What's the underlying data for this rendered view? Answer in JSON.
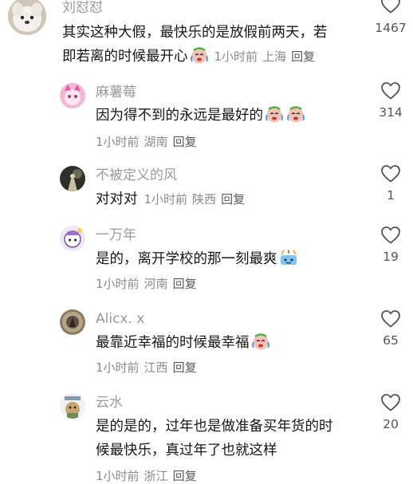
{
  "comments": [
    {
      "name": "刘怼怼",
      "lines": [
        "其实这种大假，最快乐的是放假前两天，若",
        "即若离的时候最开心"
      ],
      "emoji": "crying-face-emoji",
      "time": "1小时前",
      "location": "上海",
      "reply": "回复",
      "likes": "1467",
      "avatar": "white-dog-avatar"
    },
    {
      "name": "麻薯莓",
      "lines": [
        "因为得不到的永远是最好的"
      ],
      "emoji": "crying-face-emoji",
      "time": "1小时前",
      "location": "湖南",
      "reply": "回复",
      "likes": "314",
      "avatar": "pink-character-avatar"
    },
    {
      "name": "不被定义的风",
      "lines": [
        "对对对"
      ],
      "time": "1小时前",
      "location": "陕西",
      "reply": "回复",
      "likes": "1",
      "avatar": "dark-figure-avatar"
    },
    {
      "name": "一万年",
      "lines": [
        "是的，离开学校的那一刻最爽"
      ],
      "emoji": "celebration-emoji",
      "time": "1小时前",
      "location": "河南",
      "reply": "回复",
      "likes": "19",
      "avatar": "purple-character-avatar"
    },
    {
      "name": "Alicx. x",
      "lines": [
        "最靠近幸福的时候最幸福"
      ],
      "emoji": "crying-face-emoji",
      "time": "1小时前",
      "location": "江西",
      "reply": "回复",
      "likes": "65",
      "avatar": "sepia-photo-avatar"
    },
    {
      "name": "云水",
      "lines": [
        "是的是的，过年也是做准备买年货的时",
        "候最快乐，真过年了也就这样"
      ],
      "time": "1小时前",
      "location": "浙江",
      "reply": "回复",
      "likes": "20",
      "avatar": "dog-in-clothes-avatar"
    }
  ],
  "colors": {
    "name": "#9a9a9a",
    "text": "#161616",
    "meta": "#8a8a8a",
    "heart_outline": "#555555"
  },
  "icons": {
    "like": "heart-outline-icon"
  }
}
